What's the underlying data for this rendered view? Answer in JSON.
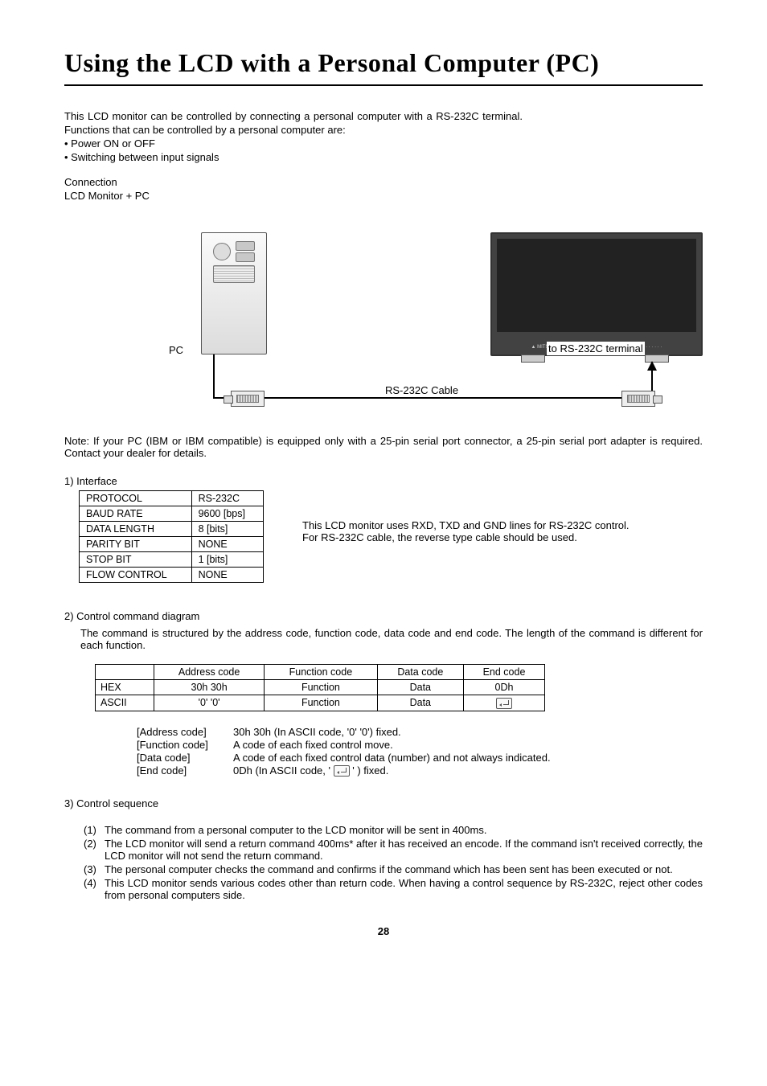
{
  "title": "Using the LCD with a Personal Computer (PC)",
  "intro": {
    "p1": "This LCD monitor can be controlled by connecting a personal computer with a RS-232C terminal.",
    "p2": "Functions that can be controlled by a personal computer are:",
    "b1": "• Power ON or OFF",
    "b2": "• Switching between input signals",
    "conn": "Connection",
    "conn2": "LCD Monitor + PC"
  },
  "diagram": {
    "pc": "PC",
    "rs_terminal": "to RS-232C terminal",
    "cable": "RS-232C Cable"
  },
  "note": "Note: If your PC (IBM or IBM compatible) is equipped only with a 25-pin serial port connector, a 25-pin serial port adapter is required.  Contact your dealer for details.",
  "iface": {
    "heading": "1) Interface",
    "rows": [
      {
        "k": "PROTOCOL",
        "v": "RS-232C"
      },
      {
        "k": "BAUD RATE",
        "v": "9600 [bps]"
      },
      {
        "k": "DATA LENGTH",
        "v": "8 [bits]"
      },
      {
        "k": "PARITY BIT",
        "v": "NONE"
      },
      {
        "k": "STOP BIT",
        "v": "1 [bits]"
      },
      {
        "k": "FLOW CONTROL",
        "v": "NONE"
      }
    ],
    "note1": "This LCD monitor uses RXD, TXD and GND lines for RS-232C control.",
    "note2": "For RS-232C cable, the reverse type cable should be used."
  },
  "cmd": {
    "heading": "2) Control command diagram",
    "para": "The command is structured by the address code, function code, data code and end code.  The length of the command is different for each function.",
    "headers": [
      "",
      "Address code",
      "Function code",
      "Data code",
      "End code"
    ],
    "hex": {
      "label": "HEX",
      "addr": "30h 30h",
      "func": "Function",
      "data": "Data",
      "end": "0Dh"
    },
    "ascii": {
      "label": "ASCII",
      "addr": "'0' '0'",
      "func": "Function",
      "data": "Data",
      "end_icon": true
    },
    "defs": [
      {
        "k": "[Address code]",
        "v": "30h 30h (In ASCII code, '0' '0') fixed."
      },
      {
        "k": "[Function code]",
        "v": "A code of each fixed control move."
      },
      {
        "k": "[Data code]",
        "v": "A code of each fixed control data (number) and not always indicated."
      },
      {
        "k": "[End code]",
        "v_pre": "0Dh (In ASCII code, ' ",
        "v_post": " ' ) fixed."
      }
    ]
  },
  "seq": {
    "heading": "3) Control sequence",
    "items": [
      {
        "n": "(1)",
        "t": "The command from a personal computer to the LCD monitor will be sent in 400ms."
      },
      {
        "n": "(2)",
        "t": "The LCD monitor will send a return command 400ms* after it has received an encode.  If the command isn't received correctly, the LCD monitor will not send the return command."
      },
      {
        "n": "(3)",
        "t": "The personal computer checks the command and confirms if the command which has  been sent has been executed or not."
      },
      {
        "n": "(4)",
        "t": "This LCD monitor sends various codes other than return code.  When having a control sequence by RS-232C, reject other codes from personal computers side."
      }
    ]
  },
  "pagenum": "28"
}
